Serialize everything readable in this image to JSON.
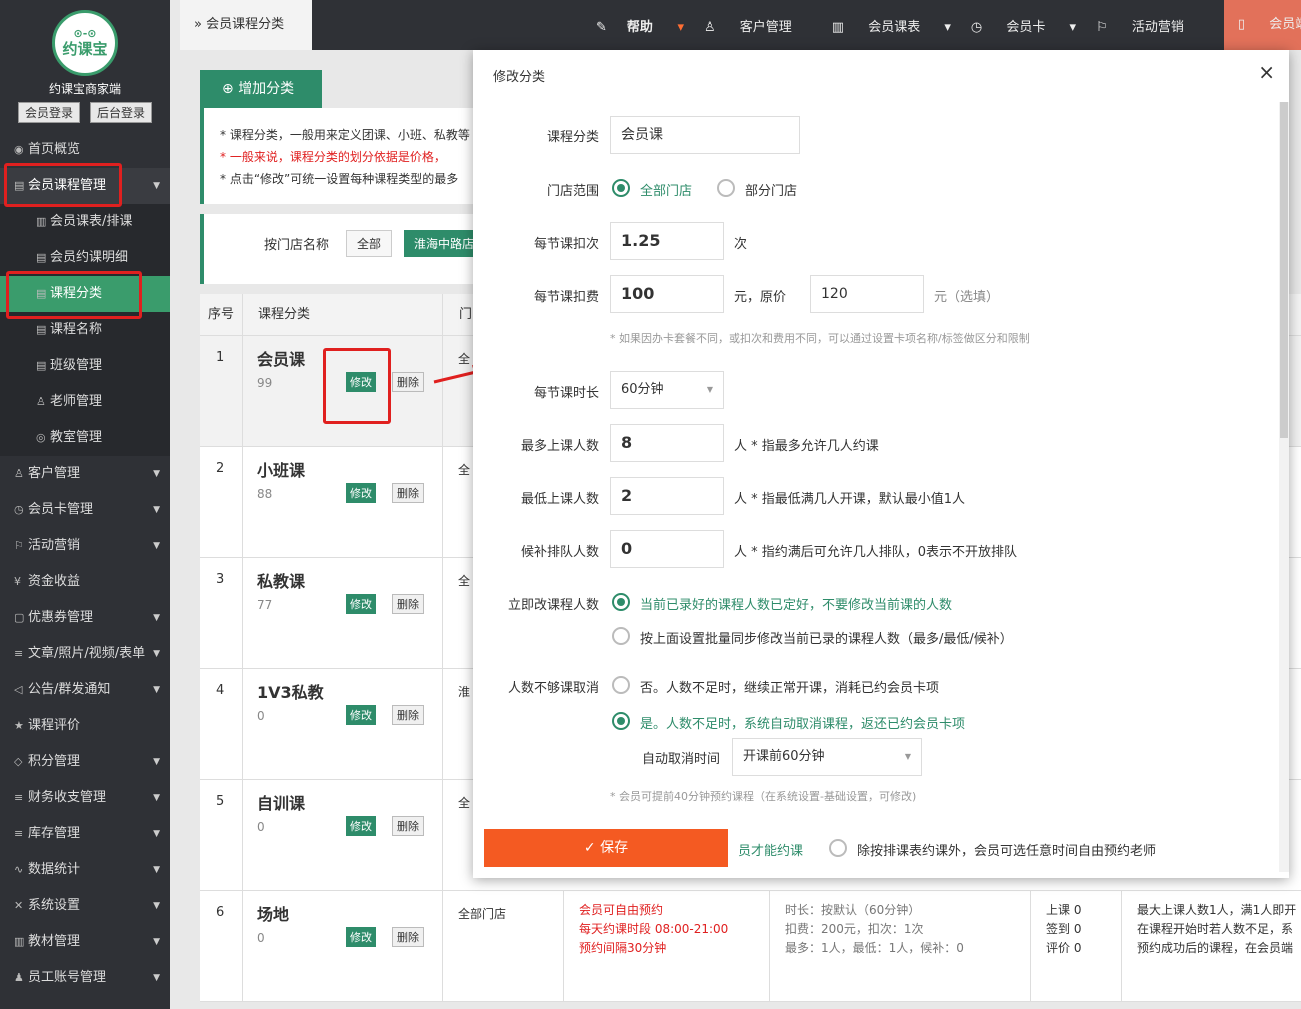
{
  "sidebar": {
    "logo_text": "约课宝",
    "brand": "约课宝商家端",
    "login_buttons": [
      "会员登录",
      "后台登录"
    ],
    "items": [
      {
        "label": "首页概览",
        "icon": "globe-icon"
      },
      {
        "label": "会员课程管理",
        "icon": "document-icon"
      },
      {
        "label": "会员课表/排课",
        "icon": "book-icon"
      },
      {
        "label": "会员约课明细",
        "icon": "list-icon"
      },
      {
        "label": "课程分类",
        "icon": "document-icon"
      },
      {
        "label": "课程名称",
        "icon": "document-icon"
      },
      {
        "label": "班级管理",
        "icon": "document-icon"
      },
      {
        "label": "老师管理",
        "icon": "user-icon"
      },
      {
        "label": "教室管理",
        "icon": "location-icon"
      },
      {
        "label": "客户管理",
        "icon": "user-icon"
      },
      {
        "label": "会员卡管理",
        "icon": "clock-icon"
      },
      {
        "label": "活动营销",
        "icon": "flag-icon"
      },
      {
        "label": "资金收益",
        "icon": "yen-icon"
      },
      {
        "label": "优惠券管理",
        "icon": "ticket-icon"
      },
      {
        "label": "文章/照片/视频/表单",
        "icon": "sliders-icon"
      },
      {
        "label": "公告/群发通知",
        "icon": "speaker-icon"
      },
      {
        "label": "课程评价",
        "icon": "star-icon"
      },
      {
        "label": "积分管理",
        "icon": "diamond-icon"
      },
      {
        "label": "财务收支管理",
        "icon": "sliders-icon"
      },
      {
        "label": "库存管理",
        "icon": "sliders-icon"
      },
      {
        "label": "数据统计",
        "icon": "chart-icon"
      },
      {
        "label": "系统设置",
        "icon": "tools-icon"
      },
      {
        "label": "教材管理",
        "icon": "book-icon"
      },
      {
        "label": "员工账号管理",
        "icon": "user-icon"
      }
    ]
  },
  "topbar": {
    "breadcrumb": "会员课程分类",
    "nav": [
      "帮助",
      "客户管理",
      "会员课表",
      "会员卡",
      "活动营销",
      "会员端二维码",
      "我的"
    ]
  },
  "page": {
    "add_button": "增加分类",
    "tips": [
      "* 课程分类，一般用来定义团课、小班、私教等",
      "* 一般来说，课程分类的划分依据是价格，",
      "* 点击“修改”可统一设置每种课程类型的最多"
    ],
    "filter_label": "按门店名称",
    "filter_all": "全部",
    "filter_store": "淮海中路店",
    "table_headers": [
      "序号",
      "课程分类",
      "门"
    ],
    "rows": [
      {
        "num": "1",
        "name": "会员课",
        "sort": "99",
        "store": "全"
      },
      {
        "num": "2",
        "name": "小班课",
        "sort": "88",
        "store": "全"
      },
      {
        "num": "3",
        "name": "私教课",
        "sort": "77",
        "store": "全"
      },
      {
        "num": "4",
        "name": "1V3私教",
        "sort": "0",
        "store": "淮"
      },
      {
        "num": "5",
        "name": "自训课",
        "sort": "0",
        "store": "全"
      },
      {
        "num": "6",
        "name": "场地",
        "sort": "0",
        "store": "全部门店"
      }
    ],
    "edit_label": "修改",
    "delete_label": "删除",
    "row6": {
      "booking": [
        "会员可自由预约",
        "每天约课时段 08:00-21:00",
        "预约间隔30分钟"
      ],
      "rules": [
        "时长：按默认（60分钟）",
        "扣费：200元，扣次：1次",
        "最多：1人，最低：1人，候补：0"
      ],
      "stats": [
        "上课 0",
        "签到 0",
        "评价 0"
      ],
      "notes": [
        "最大上课人数1人，满1人即开",
        "在课程开始时若人数不足，系",
        "预约成功后的课程，在会员端"
      ]
    }
  },
  "modal": {
    "title": "修改分类",
    "close": "×",
    "category_label": "课程分类",
    "category_value": "会员课",
    "store_scope_label": "门店范围",
    "store_all": "全部门店",
    "store_part": "部分门店",
    "deduct_times_label": "每节课扣次",
    "deduct_times_value": "1.25",
    "deduct_times_unit": "次",
    "deduct_fee_label": "每节课扣费",
    "deduct_fee_value": "100",
    "deduct_fee_unit": "元，原价",
    "original_price_value": "120",
    "original_price_unit": "元（选填）",
    "fee_hint": "* 如果因办卡套餐不同，或扣次和费用不同，可以通过设置卡项名称/标签做区分和限制",
    "duration_label": "每节课时长",
    "duration_value": "60分钟",
    "max_label": "最多上课人数",
    "max_value": "8",
    "max_hint": "人 * 指最多允许几人约课",
    "min_label": "最低上课人数",
    "min_value": "2",
    "min_hint": "人 * 指最低满几人开课，默认最小值1人",
    "wait_label": "候补排队人数",
    "wait_value": "0",
    "wait_hint": "人 * 指约满后可允许几人排队，0表示不开放排队",
    "change_label": "立即改课程人数",
    "change_opt1": "当前已录好的课程人数已定好，不要修改当前课的人数",
    "change_opt2": "按上面设置批量同步修改当前已录的课程人数（最多/最低/候补）",
    "cancel_label": "人数不够课取消",
    "cancel_opt1": "否。人数不足时，继续正常开课，消耗已约会员卡项",
    "cancel_opt2": "是。人数不足时，系统自动取消课程，返还已约会员卡项",
    "auto_cancel_label": "自动取消时间",
    "auto_cancel_value": "开课前60分钟",
    "auto_hint": "* 会员可提前40分钟预约课程（在系统设置-基础设置，可修改)",
    "save": "保存",
    "bottom_text1": "员才能约课",
    "bottom_text2": "除按排课表约课外，会员可选任意时间自由预约老师"
  }
}
